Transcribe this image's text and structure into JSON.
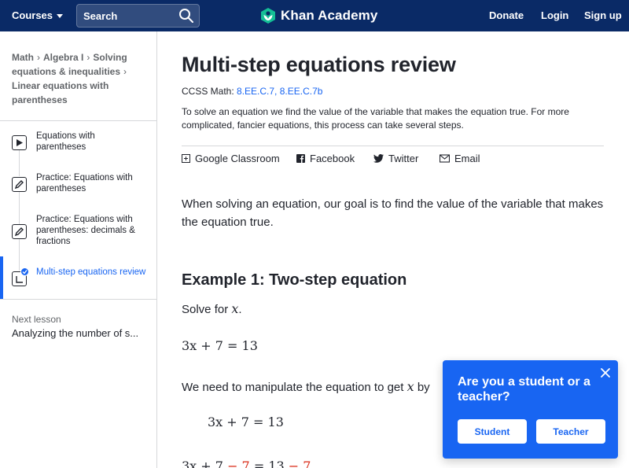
{
  "header": {
    "courses_label": "Courses",
    "search_label": "Search",
    "logo_text": "Khan Academy",
    "donate": "Donate",
    "login": "Login",
    "signup": "Sign up"
  },
  "sidebar": {
    "breadcrumb": [
      "Math",
      "Algebra I",
      "Solving equations & inequalities",
      "Linear equations with parentheses"
    ],
    "items": [
      {
        "label": "Equations with parentheses",
        "icon": "play-icon"
      },
      {
        "label": "Practice: Equations with parentheses",
        "icon": "pencil-icon"
      },
      {
        "label": "Practice: Equations with parentheses: decimals & fractions",
        "icon": "pencil-icon"
      },
      {
        "label": "Multi-step equations review",
        "icon": "article-icon",
        "active": true
      }
    ],
    "next_caption": "Next lesson",
    "next_title": "Analyzing the number of s..."
  },
  "article": {
    "title": "Multi-step equations review",
    "ccss_prefix": "CCSS Math:",
    "ccss_links": "8.EE.C.7, 8.EE.C.7b",
    "intro": "To solve an equation we find the value of the variable that makes the equation true. For more complicated, fancier equations, this process can take several steps.",
    "share": {
      "classroom": "Google Classroom",
      "facebook": "Facebook",
      "twitter": "Twitter",
      "email": "Email"
    },
    "paragraph": "When solving an equation, our goal is to find the value of the variable that makes the equation true.",
    "example_heading": "Example 1: Two-step equation",
    "solve_text": "Solve for",
    "variable": "x",
    "equation": "3x + 7 = 13",
    "manip_text": "We need to manipulate the equation to get",
    "manip_tail": "by",
    "eq_step_left": "3x + 7",
    "eq_step_minus": "− 7",
    "eq_step_mid": "= 13",
    "eq_step_minus2": "− 7"
  },
  "popup": {
    "question": "Are you a student or a teacher?",
    "student": "Student",
    "teacher": "Teacher"
  },
  "colors": {
    "header_bg": "#0a2a66",
    "accent": "#1865f2",
    "red": "#d92916"
  }
}
